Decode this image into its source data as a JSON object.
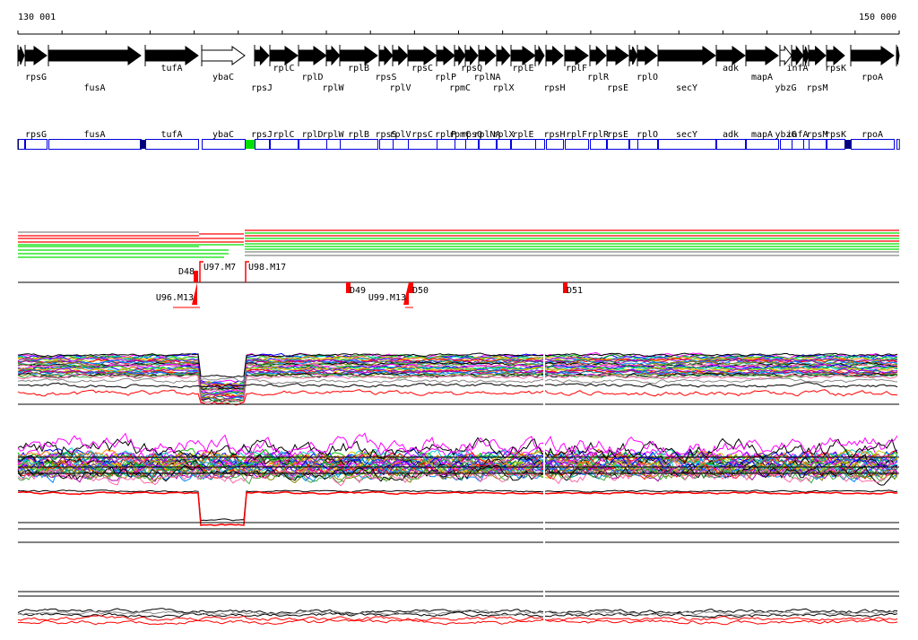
{
  "ruler": {
    "start_label": "130 001",
    "end_label": "150 000"
  },
  "genes": [
    {
      "name": "",
      "strand": "+",
      "fill": "black"
    },
    {
      "name": "rpsG",
      "fill": "black"
    },
    {
      "name": "fusA",
      "fill": "black",
      "highlight": "#000080"
    },
    {
      "name": "tufA",
      "fill": "black"
    },
    {
      "name": "ybaC",
      "fill": "white"
    },
    {
      "name": "rpsJ",
      "fill": "black",
      "highlight": "#00e000"
    },
    {
      "name": "rplC",
      "fill": "black"
    },
    {
      "name": "rplD",
      "fill": "black"
    },
    {
      "name": "rplW",
      "fill": "black"
    },
    {
      "name": "rplB",
      "fill": "black"
    },
    {
      "name": "rpsS",
      "fill": "black"
    },
    {
      "name": "rplV",
      "fill": "black"
    },
    {
      "name": "rpsC",
      "fill": "black"
    },
    {
      "name": "rplP",
      "fill": "black"
    },
    {
      "name": "rpmC",
      "fill": "black"
    },
    {
      "name": "rpsQ",
      "fill": "black"
    },
    {
      "name": "rplNA",
      "fill": "black"
    },
    {
      "name": "rplX",
      "fill": "black"
    },
    {
      "name": "rplE",
      "fill": "black"
    },
    {
      "name": "",
      "fill": "black"
    },
    {
      "name": "rpsH",
      "fill": "black"
    },
    {
      "name": "rplF",
      "fill": "black"
    },
    {
      "name": "rplR",
      "fill": "black"
    },
    {
      "name": "rpsE",
      "fill": "black"
    },
    {
      "name": "",
      "fill": "black"
    },
    {
      "name": "rplO",
      "fill": "black"
    },
    {
      "name": "secY",
      "fill": "black"
    },
    {
      "name": "adk",
      "fill": "black"
    },
    {
      "name": "mapA",
      "fill": "black"
    },
    {
      "name": "ybzG",
      "fill": "white"
    },
    {
      "name": "infA",
      "fill": "black"
    },
    {
      "name": "",
      "fill": "black"
    },
    {
      "name": "rpsM",
      "fill": "black"
    },
    {
      "name": "rpsK",
      "fill": "black",
      "highlight": "#000080"
    },
    {
      "name": "rpoA",
      "fill": "black"
    },
    {
      "name": "",
      "fill": "black"
    }
  ],
  "markers": [
    {
      "label": "D48",
      "type": "D"
    },
    {
      "label": "U97.M7",
      "type": "U"
    },
    {
      "label": "U98.M17",
      "type": "U"
    },
    {
      "label": "U96.M13",
      "type": "U"
    },
    {
      "label": "D49",
      "type": "D"
    },
    {
      "label": "U99.M13",
      "type": "U"
    },
    {
      "label": "D50",
      "type": "D"
    },
    {
      "label": "D51",
      "type": "D"
    }
  ],
  "colors": {
    "box": "#0000e0",
    "mark": "#ff0000",
    "green": "#00e000"
  }
}
